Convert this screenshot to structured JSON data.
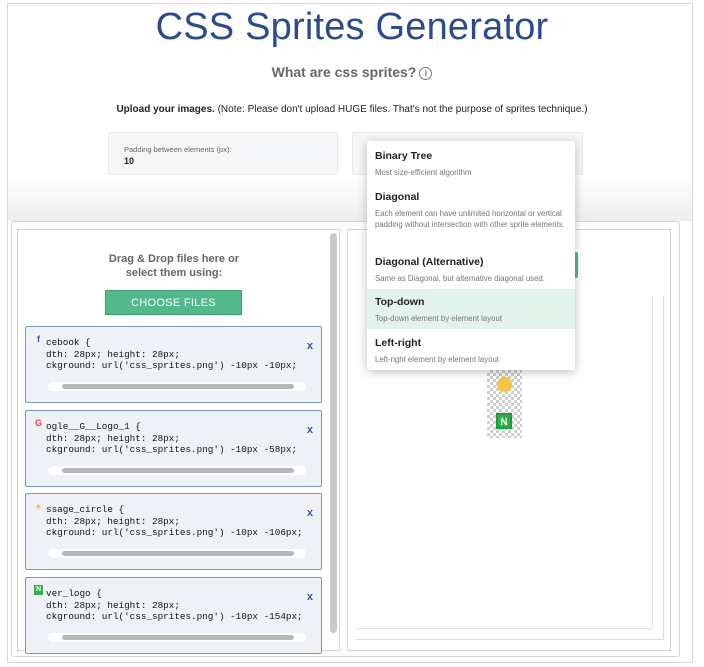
{
  "header": {
    "title": "CSS Sprites Generator",
    "subtitle": "What are css sprites?",
    "info_icon": "i"
  },
  "upload": {
    "bold": "Upload your images.",
    "note": " (Note: Please don't upload HUGE files. That's not the purpose of sprites technique.)"
  },
  "padding_field": {
    "label": "Padding between elements (px):",
    "value": "10"
  },
  "dropzone": {
    "line1": "Drag & Drop files here or",
    "line2": "select them using:",
    "button": "CHOOSE FILES"
  },
  "cards": [
    {
      "icon": "f",
      "icon_color": "#3b5998",
      "line1": "cebook {",
      "line2": "dth: 28px; height: 28px;",
      "line3": "ckground: url('css_sprites.png') -10px -10px;",
      "close": "x"
    },
    {
      "icon": "G",
      "icon_color": "#ea4335",
      "line1": "ogle__G__Logo_1 {",
      "line2": "dth: 28px; height: 28px;",
      "line3": "ckground: url('css_sprites.png') -10px -58px;",
      "close": "x"
    },
    {
      "icon": "●",
      "icon_color": "#f5c542",
      "line1": "ssage_circle {",
      "line2": "dth: 28px; height: 28px;",
      "line3": "ckground: url('css_sprites.png') -10px -106px;",
      "close": "x"
    },
    {
      "icon": "N",
      "icon_color": "#2db34a",
      "line1": "ver_logo {",
      "line2": "dth: 28px; height: 28px;",
      "line3": "ckground: url('css_sprites.png') -10px -154px;",
      "close": "x"
    }
  ],
  "preview": {
    "n_glyph": "N"
  },
  "algorithm_menu": {
    "selected": "Top-down",
    "options": [
      {
        "title": "Binary Tree",
        "desc": "Most size-efficient algorithm"
      },
      {
        "title": "Diagonal",
        "desc": "Each element can have unlimited horizontal or vertical padding without intersection with other sprite elements."
      },
      {
        "title": "Diagonal (Alternative)",
        "desc": "Same as Diagonal, but alternative diagonal used."
      },
      {
        "title": "Top-down",
        "desc": "Top-down element by element layout"
      },
      {
        "title": "Left-right",
        "desc": "Left-right element by element layout"
      }
    ]
  },
  "colors": {
    "title": "#2a4b8d",
    "accent_green": "#52b98a",
    "active_option_bg": "#e2f3ec",
    "card_border": "#7a97c4"
  }
}
